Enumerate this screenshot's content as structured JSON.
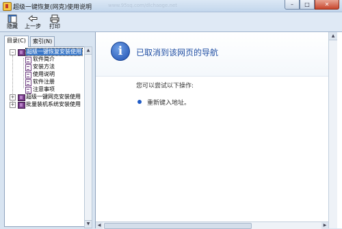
{
  "window": {
    "title": "超级一键恢复(网克)使用说明",
    "faint_text": "www.95sq.com/dlchaoge.net",
    "minimize_label": "–",
    "maximize_label": "□",
    "close_label": "✕"
  },
  "toolbar": {
    "hide_label": "隐藏",
    "back_label": "上一步",
    "print_label": "打印"
  },
  "tabs": {
    "contents_label": "目录(C)",
    "index_label": "索引(N)"
  },
  "tree": {
    "expand_open": "–",
    "expand_closed": "+",
    "root": "超级一键恢复安装使用",
    "children": [
      "软件简介",
      "安装方法",
      "使用说明",
      "软件注册",
      "注意事项"
    ],
    "collapsed": [
      "超级一键网克安装使用",
      "批量装机系统安装使用"
    ]
  },
  "content": {
    "title": "已取消到该网页的导航",
    "subtext": "您可以尝试以下操作:",
    "bullet": "重新键入地址。"
  },
  "scroll": {
    "up": "▲",
    "down": "▼",
    "left": "◀",
    "right": "▶"
  }
}
